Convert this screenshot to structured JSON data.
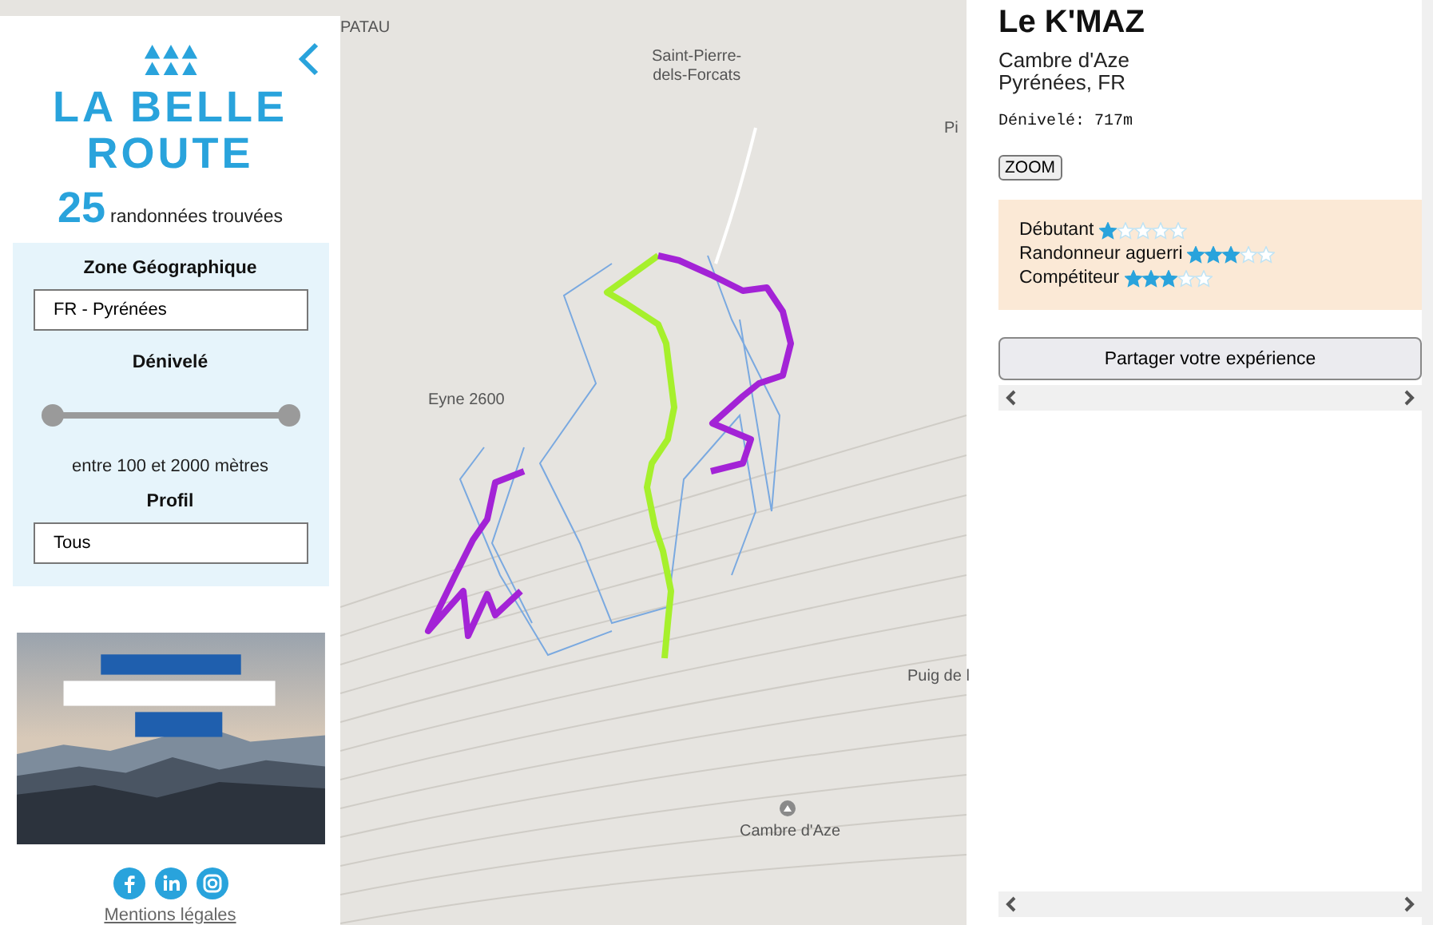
{
  "sidebar": {
    "logo_lines": [
      "LA BELLE",
      "ROUTE"
    ],
    "count": "25",
    "count_label": "randonnées trouvées",
    "filters": {
      "zone_label": "Zone Géographique",
      "zone_value": "FR - Pyrénées",
      "elevation_label": "Dénivelé",
      "slider": {
        "level": 1
      },
      "range_text": "entre 100 et 2000 mètres",
      "profile_label": "Profil",
      "profile_value": "Tous"
    },
    "footer_link": "Mentions légales"
  },
  "map": {
    "labels": [
      {
        "text": "PATAU",
        "kind": "place"
      },
      {
        "text": "Saint-Pierre-\ndels-Forcats",
        "kind": "place"
      },
      {
        "text": "Eyne 2600",
        "kind": "place"
      },
      {
        "text": "Puig de l",
        "kind": "place"
      },
      {
        "text": "Cambre d'Aze",
        "kind": "peak"
      },
      {
        "text": "Pi",
        "kind": "place"
      }
    ]
  },
  "detail": {
    "title": "Le K'MAZ",
    "place_lines": [
      "Cambre d'Aze",
      "Pyrénées, FR"
    ],
    "elevation": "Dénivelé: 717m",
    "zoom_button": "ZOOM",
    "ratings": [
      {
        "label": "Débutant",
        "stars": 1
      },
      {
        "label": "Randonneur aguerri",
        "stars": 3
      },
      {
        "label": "Compétiteur",
        "stars": 3
      }
    ],
    "share_button": "Partager votre expérience"
  }
}
